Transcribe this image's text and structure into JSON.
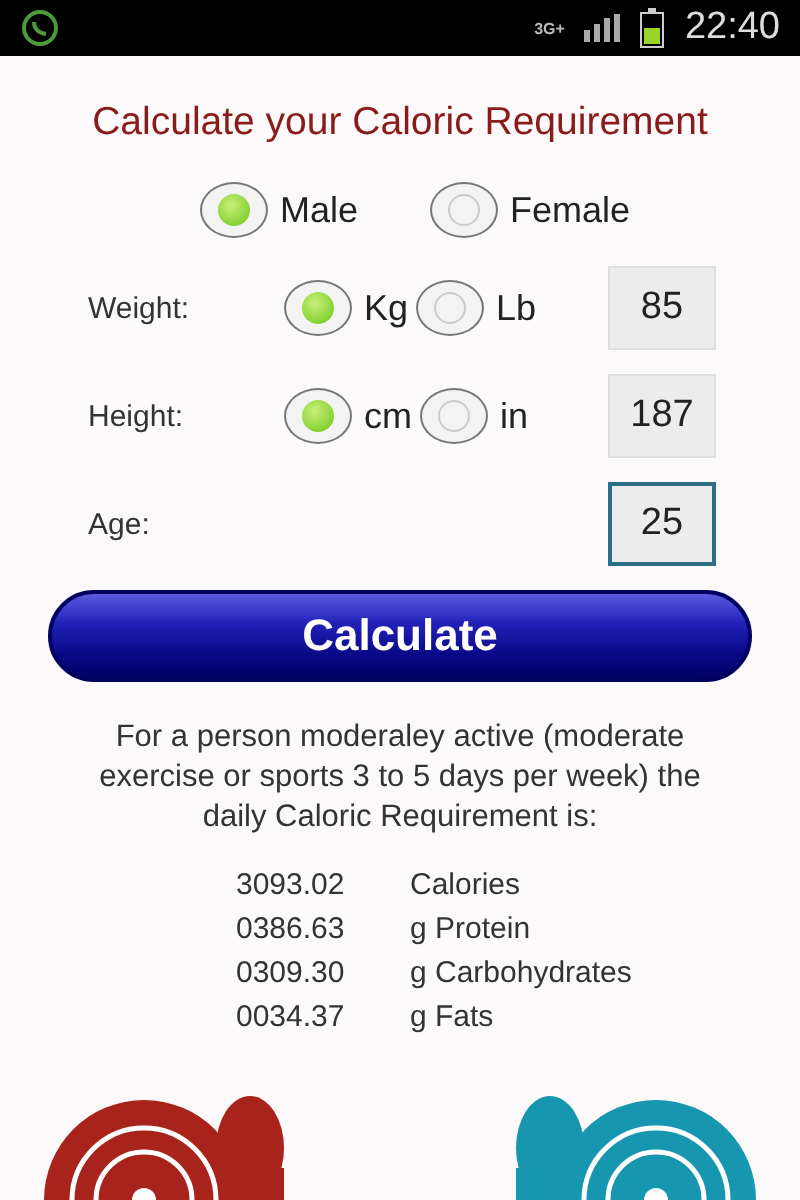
{
  "status_bar": {
    "time": "22:40",
    "network": "3G+"
  },
  "title": "Calculate your Caloric Requirement",
  "gender": [
    {
      "label": "Male",
      "selected": true
    },
    {
      "label": "Female",
      "selected": false
    }
  ],
  "fields": [
    {
      "label": "Weight:",
      "units": [
        {
          "label": "Kg",
          "selected": true
        },
        {
          "label": "Lb",
          "selected": false
        }
      ],
      "value": "85",
      "focused": false
    },
    {
      "label": "Height:",
      "units": [
        {
          "label": "cm",
          "selected": true
        },
        {
          "label": "in",
          "selected": false
        }
      ],
      "value": "187",
      "focused": false
    },
    {
      "label": "Age:",
      "value": "25",
      "focused": true
    }
  ],
  "calculate_button": "Calculate",
  "description": "For a person moderaley active (moderate exercise or sports 3 to 5 days per week) the daily Caloric Requirement is:",
  "results": [
    {
      "value": "3093.02",
      "unit": "Calories"
    },
    {
      "value": "0386.63",
      "unit": "g Protein"
    },
    {
      "value": "0309.30",
      "unit": "g Carbohydrates"
    },
    {
      "value": "0034.37",
      "unit": "g Fats"
    }
  ]
}
